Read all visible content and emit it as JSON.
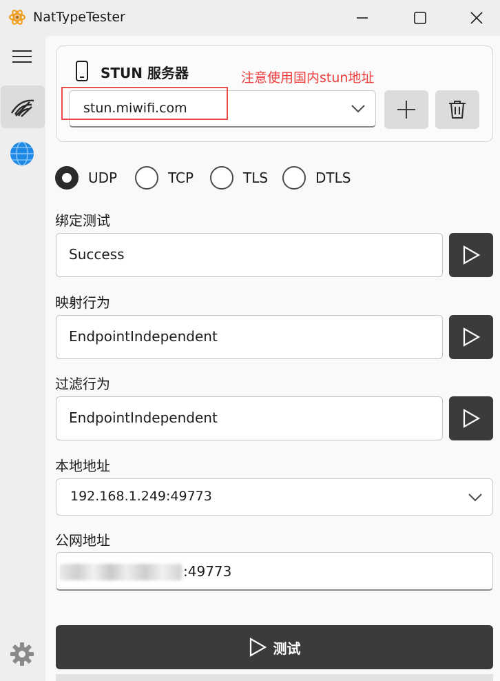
{
  "window": {
    "title": "NatTypeTester"
  },
  "stun_card": {
    "title": "STUN 服务器",
    "annotation": "注意使用国内stun地址",
    "server_value": "stun.miwifi.com"
  },
  "protocols": [
    {
      "label": "UDP",
      "checked": true
    },
    {
      "label": "TCP",
      "checked": false
    },
    {
      "label": "TLS",
      "checked": false
    },
    {
      "label": "DTLS",
      "checked": false
    }
  ],
  "fields": {
    "binding": {
      "label": "绑定测试",
      "value": "Success"
    },
    "mapping": {
      "label": "映射行为",
      "value": "EndpointIndependent"
    },
    "filtering": {
      "label": "过滤行为",
      "value": "EndpointIndependent"
    },
    "local": {
      "label": "本地地址",
      "value": "192.168.1.249:49773"
    },
    "public": {
      "label": "公网地址",
      "value_visible": ":49773"
    }
  },
  "actions": {
    "test_label": "测试"
  },
  "icons": {
    "app": "atom-icon",
    "menu": "hamburger-icon",
    "nat": "wifi-signal-icon",
    "globe": "globe-icon",
    "settings": "gear-icon",
    "phone": "mobile-phone-icon",
    "add": "plus-icon",
    "delete": "trash-icon",
    "play": "play-icon",
    "chevron": "chevron-down-icon"
  },
  "colors": {
    "annotation_red": "#ee3a3a",
    "dark_button": "#3b3b3b",
    "app_icon_orange": "#f0a020",
    "globe_blue": "#1e88e5"
  }
}
